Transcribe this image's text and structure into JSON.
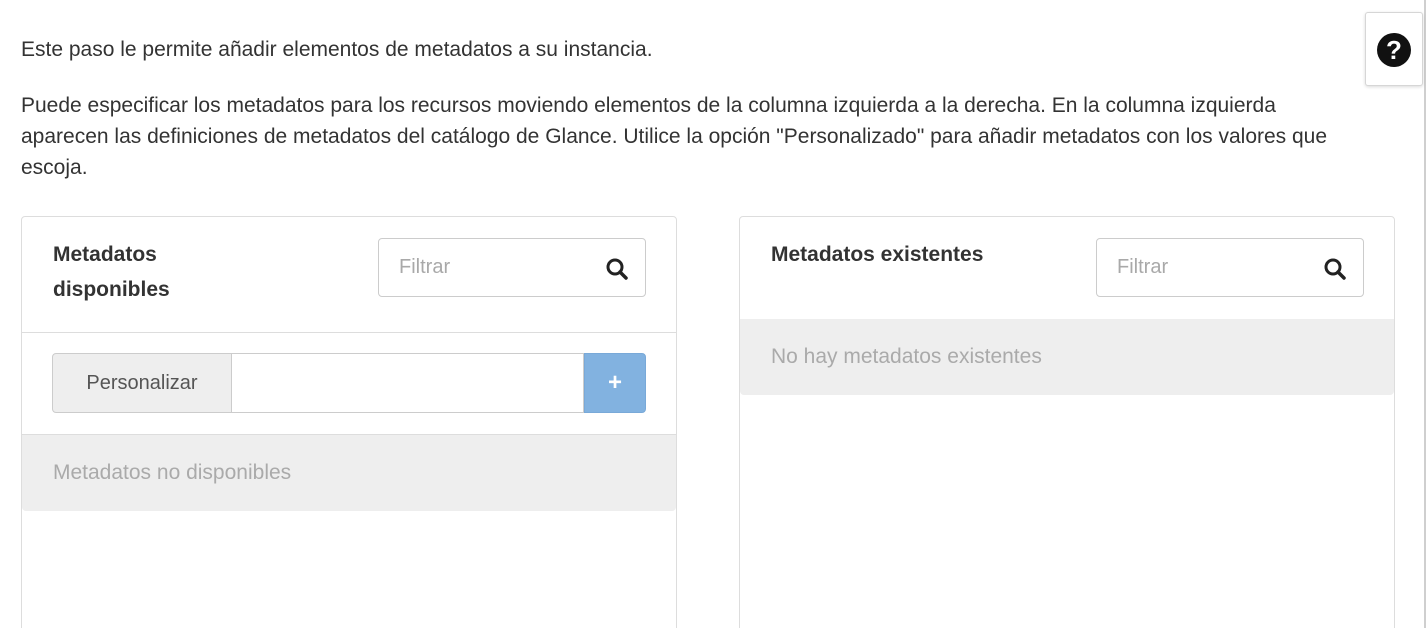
{
  "help": {
    "icon": "question-circle-icon",
    "symbol": "?"
  },
  "intro": "Este paso le permite añadir elementos de metadatos a su instancia.",
  "description": "Puede especificar los metadatos para los recursos moviendo elementos de la columna izquierda a la derecha. En la columna izquierda aparecen las definiciones de metadatos del catálogo de Glance. Utilice la opción \"Personalizado\" para añadir metadatos con los valores que escoja.",
  "available": {
    "title": "Metadatos disponibles",
    "filter_placeholder": "Filtrar",
    "custom_label": "Personalizar",
    "custom_value": "",
    "add_symbol": "+",
    "empty_text": "Metadatos no disponibles"
  },
  "existing": {
    "title": "Metadatos existentes",
    "filter_placeholder": "Filtrar",
    "empty_text": "No hay metadatos existentes"
  },
  "colors": {
    "add_button": "#82b2e0",
    "empty_row_bg": "#eeeeee",
    "border": "#dddddd"
  }
}
